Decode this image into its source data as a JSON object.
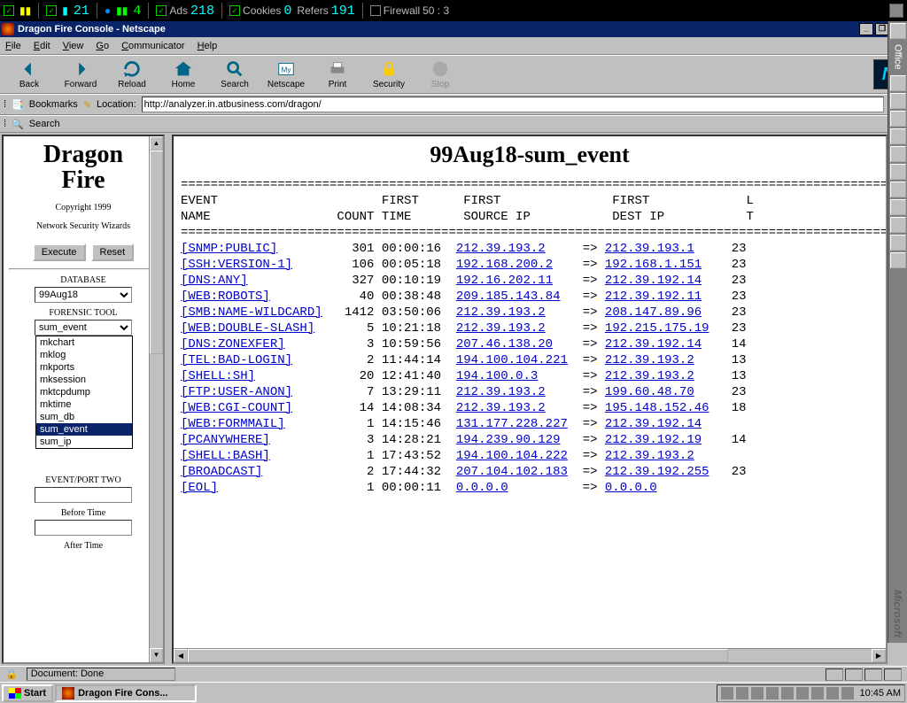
{
  "sysbar": {
    "val1": "21",
    "val2": "4",
    "ads_label": "Ads",
    "ads": "218",
    "cookies_label": "Cookies",
    "cookies": "0",
    "refers_label": "Refers",
    "refers": "191",
    "firewall_label": "Firewall",
    "firewall": "50 : 3"
  },
  "window": {
    "title": "Dragon Fire Console - Netscape"
  },
  "menu": {
    "file": "File",
    "edit": "Edit",
    "view": "View",
    "go": "Go",
    "communicator": "Communicator",
    "help": "Help"
  },
  "toolbar": {
    "back": "Back",
    "forward": "Forward",
    "reload": "Reload",
    "home": "Home",
    "search": "Search",
    "netscape": "Netscape",
    "print": "Print",
    "security": "Security",
    "stop": "Stop"
  },
  "location": {
    "bookmarks": "Bookmarks",
    "label": "Location:",
    "url": "http://analyzer.in.atbusiness.com/dragon/"
  },
  "searchtab": "Search",
  "sidebar": {
    "title1": "Dragon",
    "title2": "Fire",
    "copyright": "Copyright 1999",
    "subtitle": "Network Security Wizards",
    "execute": "Execute",
    "reset": "Reset",
    "database_label": "DATABASE",
    "database_value": "99Aug18",
    "tool_label": "FORENSIC TOOL",
    "tool_value": "sum_event",
    "dropdown_items": [
      "mkchart",
      "mklog",
      "mkports",
      "mksession",
      "mktcpdump",
      "mktime",
      "sum_db",
      "sum_event",
      "sum_ip"
    ],
    "dropdown_selected": "sum_event",
    "eventport_label": "EVENT/PORT TWO",
    "before_label": "Before Time",
    "after_label": "After Time"
  },
  "main": {
    "heading": "99Aug18-sum_event",
    "rule": "==================================================================================================",
    "col1": "EVENT",
    "col2": "NAME",
    "col3": "COUNT",
    "col4": "FIRST",
    "col5": "TIME",
    "col6": "FIRST",
    "col7": "SOURCE IP",
    "col8": "FIRST",
    "col9": "DEST IP",
    "col_last_frag": "L",
    "col_t_frag": "T",
    "rows": [
      {
        "event": "[SNMP:PUBLIC]",
        "count": "301",
        "time": "00:00:16",
        "src": "212.39.193.2",
        "dst": "212.39.193.1",
        "tail": "23"
      },
      {
        "event": "[SSH:VERSION-1]",
        "count": "106",
        "time": "00:05:18",
        "src": "192.168.200.2",
        "dst": "192.168.1.151",
        "tail": "23"
      },
      {
        "event": "[DNS:ANY]",
        "count": "327",
        "time": "00:10:19",
        "src": "192.16.202.11",
        "dst": "212.39.192.14",
        "tail": "23"
      },
      {
        "event": "[WEB:ROBOTS]",
        "count": "40",
        "time": "00:38:48",
        "src": "209.185.143.84",
        "dst": "212.39.192.11",
        "tail": "23"
      },
      {
        "event": "[SMB:NAME-WILDCARD]",
        "count": "1412",
        "time": "03:50:06",
        "src": "212.39.193.2",
        "dst": "208.147.89.96",
        "tail": "23"
      },
      {
        "event": "[WEB:DOUBLE-SLASH]",
        "count": "5",
        "time": "10:21:18",
        "src": "212.39.193.2",
        "dst": "192.215.175.19",
        "tail": "23"
      },
      {
        "event": "[DNS:ZONEXFER]",
        "count": "3",
        "time": "10:59:56",
        "src": "207.46.138.20",
        "dst": "212.39.192.14",
        "tail": "14"
      },
      {
        "event": "[TEL:BAD-LOGIN]",
        "count": "2",
        "time": "11:44:14",
        "src": "194.100.104.221",
        "dst": "212.39.193.2",
        "tail": "13"
      },
      {
        "event": "[SHELL:SH]",
        "count": "20",
        "time": "12:41:40",
        "src": "194.100.0.3",
        "dst": "212.39.193.2",
        "tail": "13"
      },
      {
        "event": "[FTP:USER-ANON]",
        "count": "7",
        "time": "13:29:11",
        "src": "212.39.193.2",
        "dst": "199.60.48.70",
        "tail": "23"
      },
      {
        "event": "[WEB:CGI-COUNT]",
        "count": "14",
        "time": "14:08:34",
        "src": "212.39.193.2",
        "dst": "195.148.152.46",
        "tail": "18"
      },
      {
        "event": "[WEB:FORMMAIL]",
        "count": "1",
        "time": "14:15:46",
        "src": "131.177.228.227",
        "dst": "212.39.192.14",
        "tail": ""
      },
      {
        "event": "[PCANYWHERE]",
        "count": "3",
        "time": "14:28:21",
        "src": "194.239.90.129",
        "dst": "212.39.192.19",
        "tail": "14"
      },
      {
        "event": "[SHELL:BASH]",
        "count": "1",
        "time": "17:43:52",
        "src": "194.100.104.222",
        "dst": "212.39.193.2",
        "tail": ""
      },
      {
        "event": "[BROADCAST]",
        "count": "2",
        "time": "17:44:32",
        "src": "207.104.102.183",
        "dst": "212.39.192.255",
        "tail": "23"
      },
      {
        "event": "[EOL]",
        "count": "1",
        "time": "00:00:11",
        "src": "0.0.0.0",
        "dst": "0.0.0.0",
        "tail": ""
      }
    ],
    "arrow": "=>"
  },
  "status": {
    "document_done": "Document: Done"
  },
  "taskbar": {
    "start": "Start",
    "task": "Dragon Fire Cons...",
    "clock": "10:45 AM"
  },
  "office": {
    "label": "Office",
    "ms": "Microsoft"
  }
}
